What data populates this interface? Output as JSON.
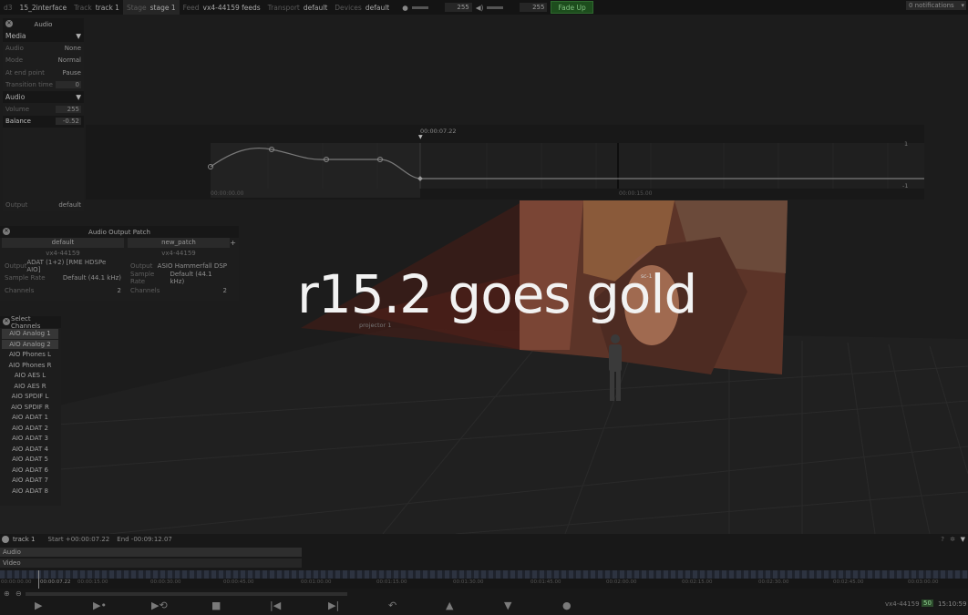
{
  "topbar": {
    "app": "d3",
    "project": "15_2interface",
    "track_label": "Track",
    "track": "track 1",
    "stage_label": "Stage",
    "stage": "stage 1",
    "feed_label": "Feed",
    "feed": "vx4-44159 feeds",
    "transport_label": "Transport",
    "transport": "default",
    "devices_label": "Devices",
    "devices": "default",
    "volume1": "255",
    "volume2": "255",
    "fade_up": "Fade Up",
    "notifications": "0 notifications"
  },
  "audio_panel": {
    "title": "Audio",
    "media_section": "Media",
    "media_rows": [
      {
        "label": "Audio",
        "value": "None"
      },
      {
        "label": "Mode",
        "value": "Normal"
      },
      {
        "label": "At end point",
        "value": "Pause"
      },
      {
        "label": "Transition time",
        "value": "0"
      }
    ],
    "audio_section": "Audio",
    "volume_label": "Volume",
    "volume_value": "255",
    "balance_label": "Balance",
    "balance_value": "-0.52",
    "output_label": "Output",
    "output_value": "default"
  },
  "curve_editor": {
    "time_marker": "00:00:07.22",
    "scale_top": "1",
    "scale_bottom": "-1",
    "time_left": "00:00:00.00",
    "time_mid": "00:00:15.00"
  },
  "patch_panel": {
    "title": "Audio Output Patch",
    "add": "+",
    "columns": [
      {
        "name": "default",
        "device": "vx4-44159",
        "output_label": "Output",
        "output": "ADAT (1+2) [RME HDSPe AIO]",
        "rate_label": "Sample Rate",
        "rate": "Default (44.1 kHz)",
        "channels_label": "Channels",
        "channels": "2"
      },
      {
        "name": "new_patch",
        "device": "vx4-44159",
        "output_label": "Output",
        "output": "ASIO Hammerfall DSP",
        "rate_label": "Sample Rate",
        "rate": "Default (44.1 kHz)",
        "channels_label": "Channels",
        "channels": "2"
      }
    ]
  },
  "channels_panel": {
    "title": "Select Channels",
    "items": [
      "AIO Analog 1",
      "AIO Analog 2",
      "AIO Phones L",
      "AIO Phones R",
      "AIO AES L",
      "AIO AES R",
      "AIO SPDIF L",
      "AIO SPDIF R",
      "AIO ADAT 1",
      "AIO ADAT 2",
      "AIO ADAT 3",
      "AIO ADAT 4",
      "AIO ADAT 5",
      "AIO ADAT 6",
      "AIO ADAT 7",
      "AIO ADAT 8"
    ]
  },
  "stage": {
    "projector_label": "projector 1",
    "screen_label": "sc-1"
  },
  "overlay_title": "r15.2 goes gold",
  "timeline": {
    "track": "track 1",
    "start": "Start +00:00:07.22",
    "end": "End -00:09:12.07",
    "layers": [
      "Audio",
      "Video"
    ],
    "ticks": [
      "00:00:00.00",
      "00:00:07.22",
      "00:00:15.00",
      "00:00:30.00",
      "00:00:45.00",
      "00:01:00.00",
      "00:01:15.00",
      "00:01:30.00",
      "00:01:45.00",
      "00:02:00.00",
      "00:02:15.00",
      "00:02:30.00",
      "00:02:45.00",
      "00:03:00.00"
    ],
    "machine": "vx4-44159",
    "fps": "50",
    "clock": "15:10:59"
  }
}
